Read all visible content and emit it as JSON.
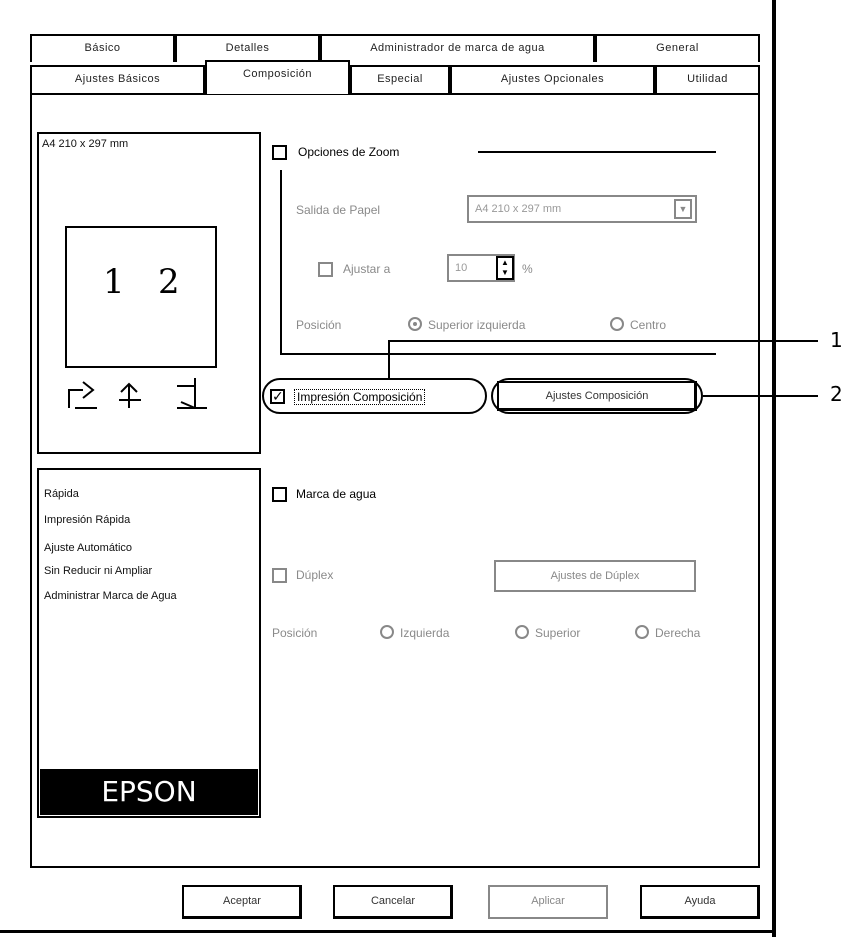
{
  "tabs_top": [
    "Básico",
    "Detalles",
    "Administrador de marca de agua",
    "General"
  ],
  "tabs_bottom": [
    "Ajustes Básicos",
    "Composición",
    "Especial",
    "Ajustes Opcionales",
    "Utilidad"
  ],
  "preview": {
    "paper_label": "A4 210 x 297 mm",
    "page_numbers": [
      "1",
      "2"
    ]
  },
  "info_box": {
    "lines": [
      "Rápida",
      "Impresión Rápida",
      "Ajuste Automático",
      "Sin Reducir ni Ampliar",
      "Administrar Marca de Agua"
    ]
  },
  "brand": "EPSON",
  "zoom": {
    "checkbox_label": "Opciones de Zoom",
    "paper_output_label": "Salida de Papel",
    "paper_output_value": "A4 210 x 297 mm",
    "zoom_to_label": "Ajustar a",
    "zoom_value": "10",
    "zoom_unit": "%",
    "position_label": "Posición",
    "position_options": [
      "Superior izquierda",
      "Centro"
    ]
  },
  "print_layout": {
    "checkbox_label": "Impresión Composición",
    "checked": true,
    "settings_button": "Ajustes Composición"
  },
  "duplex": {
    "checkbox_label": "Marca de agua",
    "duplex_label": "Dúplex",
    "duplex_button": "Ajustes de Dúplex",
    "position_label": "Posición",
    "position_options": [
      "Izquierda",
      "Superior",
      "Derecha"
    ]
  },
  "callouts": [
    "1",
    "2"
  ],
  "footer_buttons": [
    "Aceptar",
    "Cancelar",
    "Aplicar",
    "Ayuda"
  ]
}
